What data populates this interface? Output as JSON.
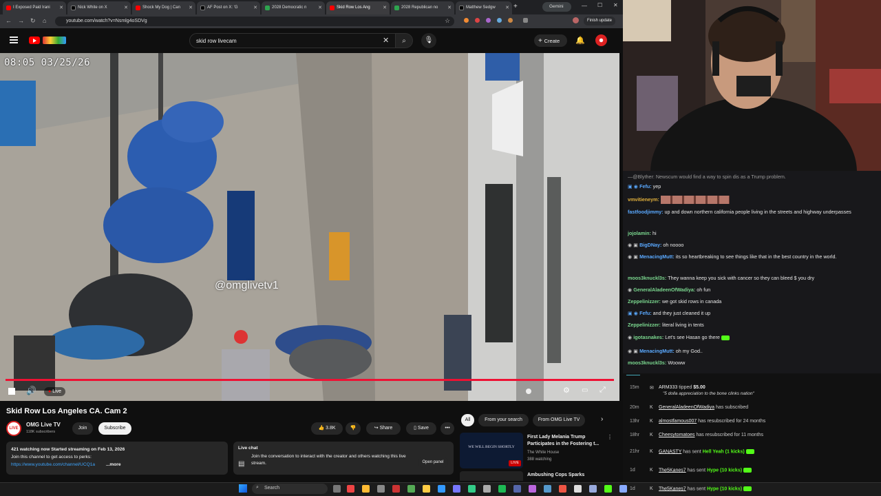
{
  "browser": {
    "tabs": [
      {
        "label": "I Exposed Paid Irani"
      },
      {
        "label": "Nick White on X"
      },
      {
        "label": "Shock My Dog | Can"
      },
      {
        "label": "AF Post on X: 'G"
      },
      {
        "label": "2028 Democratic n"
      },
      {
        "label": "Skid Row Los Ang"
      },
      {
        "label": "2028 Republican no"
      },
      {
        "label": "Matthew Sedgw"
      }
    ],
    "gemini_label": "Gemini",
    "url": "youtube.com/watch?v=Nsmlg4oSDVg",
    "finish_update": "Finish update"
  },
  "youtube": {
    "search_value": "skid row livecam",
    "create_label": "Create"
  },
  "video": {
    "timestamp": "08:05 03/25/26",
    "watermark": "@omglivetv1",
    "live_label": "Live",
    "progress": 1.0
  },
  "details": {
    "title": "Skid Row Los Angeles CA. Cam 2",
    "channel_name": "OMG Live TV",
    "subscribers": "118K subscribers",
    "join_label": "Join",
    "subscribe_label": "Subscribe",
    "likes": "3.8K",
    "share_label": "Share",
    "save_label": "Save",
    "description_line1": "421 watching now  Started streaming on Feb 13, 2026",
    "description_line2": "Join this channel to get access to perks:",
    "description_link": "https://www.youtube.com/channel/UCQ1a",
    "more_label": "...more",
    "live_chat_title": "Live chat",
    "live_chat_text": "Join the conversation to interact with the creator and others watching this live stream.",
    "open_panel_label": "Open panel"
  },
  "suggestions": {
    "chips": [
      "All",
      "From your search",
      "From OMG Live TV"
    ],
    "item1_title": "First Lady Melania Trump Participates in the Fostering t...",
    "item1_channel": "The White House",
    "item1_meta": "388 watching",
    "item1_live": "LIVE",
    "item1_thumb_text": "WE WILL BEGIN SHORTLY",
    "item2_title": "Ambushing Cops Sparks"
  },
  "chat": {
    "messages": [
      {
        "user": "",
        "text": "—@Blyther: Newscum would find a way to spin dis as a Trump problem."
      },
      {
        "user": "Fefu:",
        "text": "yep"
      },
      {
        "user": "vmvitieneym:",
        "text": ""
      },
      {
        "user": "fastfoodjimmy:",
        "text": "up and down northern california people living in the streets and highway underpasses"
      },
      {
        "user": "jojolamin:",
        "text": "hi"
      },
      {
        "user": "BigDNay:",
        "text": "oh noooo"
      },
      {
        "user": "MenacingMutt:",
        "text": "its so heartbreaking to see things like that in the best country in the world."
      },
      {
        "user": "moos3knuckl3s:",
        "text": "They wanna keep you sick with cancer so they can bleed $ you dry"
      },
      {
        "user": "GeneralAladeenOfWadiya:",
        "text": "oh fun"
      },
      {
        "user": "Zeppelinizzer:",
        "text": "we got skid rows in canada"
      },
      {
        "user": "Fefu:",
        "text": "and they just cleaned it up"
      },
      {
        "user": "Zeppelinizzer:",
        "text": "literal living in tents"
      },
      {
        "user": "igotasnakes:",
        "text": "Let's see Hasan go there"
      },
      {
        "user": "MenacingMutt:",
        "text": "oh my God.."
      },
      {
        "user": "moos3knuckl3s:",
        "text": "Wooww"
      }
    ]
  },
  "events": [
    {
      "time": "15m",
      "user": "ARM333",
      "action": "tipped",
      "amount": "$5.00",
      "note": "\"5 dolla appreciation to the bone clinks nation\""
    },
    {
      "time": "20m",
      "user": "GeneralAladeenOfWadiya",
      "action": "has subscribed"
    },
    {
      "time": "13hr",
      "user": "almostfamous007",
      "action": "has resubscribed for 24 months"
    },
    {
      "time": "18hr",
      "user": "Cheesytomatoes",
      "action": "has resubscribed for 11 months"
    },
    {
      "time": "21hr",
      "user": "GANASTY",
      "action": "has sent",
      "kick": "Hell Yeah (1 kicks)"
    },
    {
      "time": "1d",
      "user": "The5Kanes7",
      "action": "has sent",
      "kick": "Hype (10 kicks)"
    },
    {
      "time": "1d",
      "user": "The5Kanes7",
      "action": "has sent",
      "kick": "Hype (10 kicks)"
    }
  ],
  "taskbar": {
    "search_label": "Search"
  },
  "colors": {
    "yt_red": "#ff0000",
    "progress": "#ee1133",
    "twitch_name_green": "#7bd88f",
    "twitch_name_blue": "#5aa9ff",
    "kick_green": "#53fc18"
  }
}
